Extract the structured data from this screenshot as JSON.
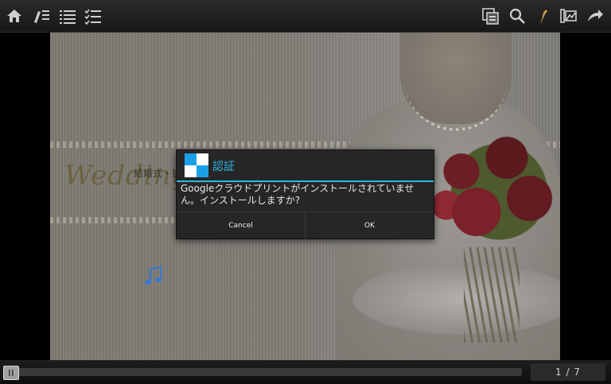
{
  "toolbar": {
    "left_icons": [
      "home-icon",
      "thumbnail-list-icon",
      "list-icon",
      "checklist-icon"
    ],
    "right_icons": [
      "page-view-icon",
      "search-icon",
      "pen-icon",
      "edit-image-icon",
      "share-arrow-icon"
    ]
  },
  "page": {
    "script_title": "Wedding",
    "subtitle_jp": "結婚式・披",
    "music_icon": "music-note-icon"
  },
  "dialog": {
    "title": "認証",
    "message": "Googleクラウドプリントがインストールされていません。インストールしますか?",
    "cancel_label": "Cancel",
    "ok_label": "OK",
    "accent_color": "#33b5e5"
  },
  "footer": {
    "page_counter": "1 / 7",
    "current_page": 1,
    "total_pages": 7
  }
}
